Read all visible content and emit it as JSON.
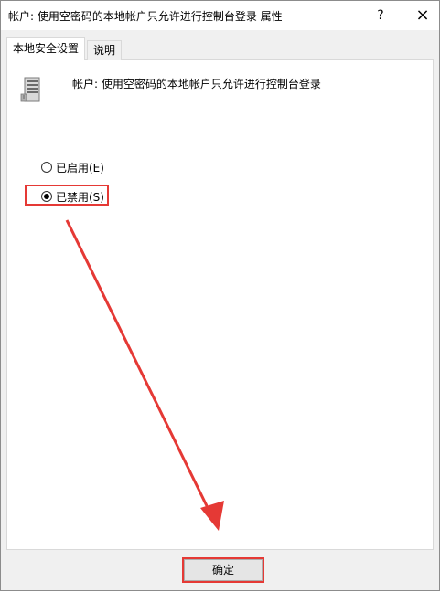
{
  "window": {
    "title": "帐户: 使用空密码的本地帐户只允许进行控制台登录 属性",
    "help_label": "?",
    "close_label": "×"
  },
  "tabs": [
    {
      "label": "本地安全设置",
      "active": true
    },
    {
      "label": "说明",
      "active": false
    }
  ],
  "policy": {
    "name": "帐户: 使用空密码的本地帐户只允许进行控制台登录",
    "icon": "server-policy-icon"
  },
  "options": [
    {
      "label": "已启用(E)",
      "checked": false
    },
    {
      "label": "已禁用(S)",
      "checked": true
    }
  ],
  "buttons": {
    "ok_label": "确定"
  },
  "annotation": {
    "color": "#e53935"
  }
}
